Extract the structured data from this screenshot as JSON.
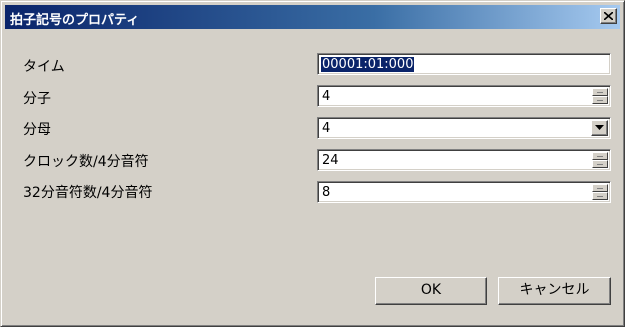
{
  "window": {
    "title": "拍子記号のプロパティ",
    "close_glyph": "×"
  },
  "fields": {
    "time": {
      "label": "タイム",
      "value": "00001:01:000"
    },
    "numerator": {
      "label": "分子",
      "value": "4"
    },
    "denominator": {
      "label": "分母",
      "value": "4"
    },
    "clocks": {
      "label": "クロック数/4分音符",
      "value": "24"
    },
    "thirtyseconds": {
      "label": "32分音符数/4分音符",
      "value": "8"
    }
  },
  "buttons": {
    "ok": "OK",
    "cancel": "キャンセル"
  },
  "colors": {
    "title_gradient_start": "#0a246a",
    "title_gradient_end": "#a6caf0",
    "face": "#d4d0c8",
    "selection": "#0a246a"
  },
  "icons": {
    "close": "close-icon",
    "dropdown": "chevron-down-icon",
    "spinner": "spinner-arrows-icon"
  }
}
